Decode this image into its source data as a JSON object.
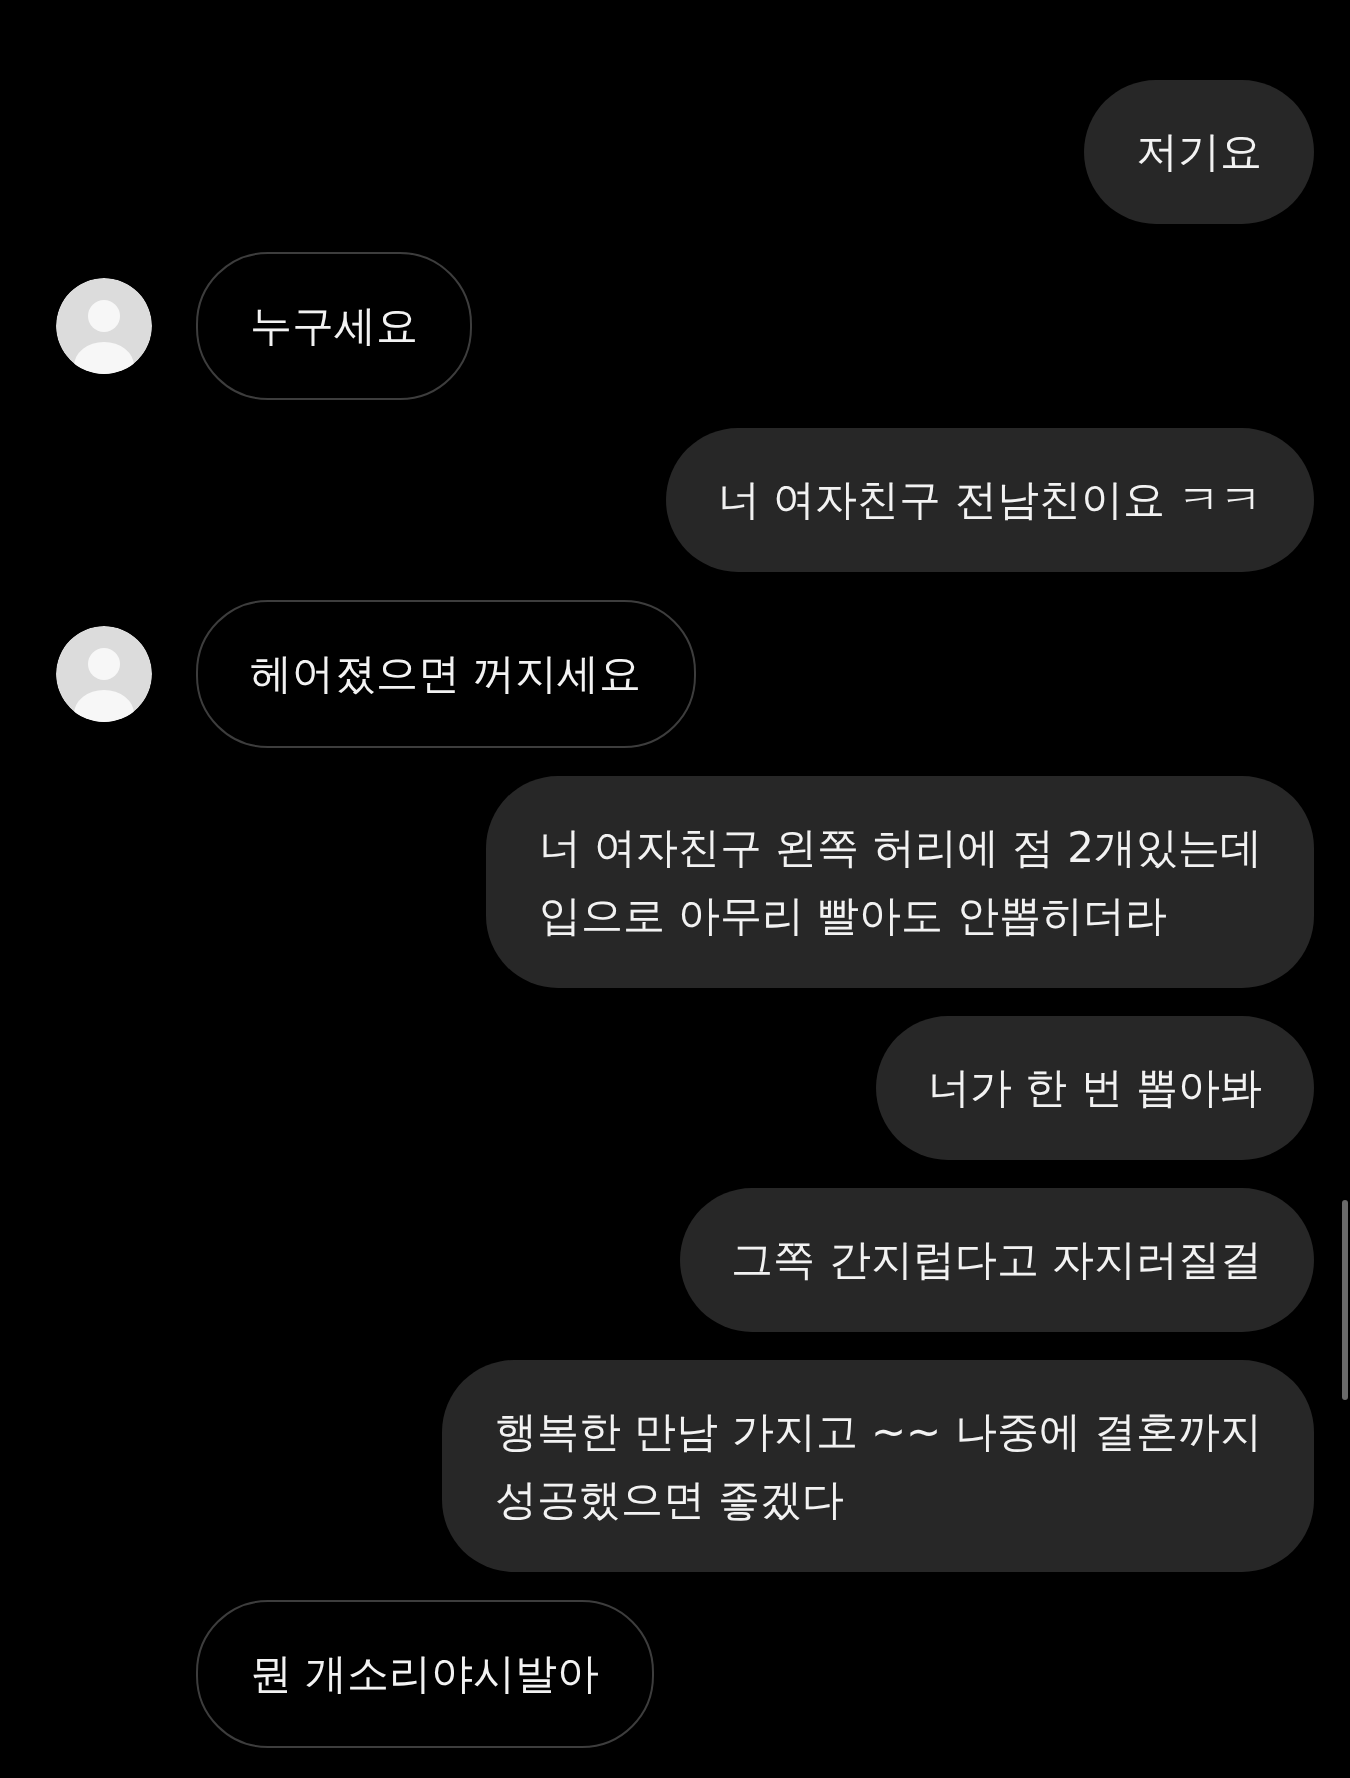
{
  "messages": [
    {
      "kind": "sent",
      "text": "저기요"
    },
    {
      "kind": "received",
      "text": "누구세요",
      "avatar": true
    },
    {
      "kind": "sent",
      "text": "너 여자친구 전남친이요 ㅋㅋ"
    },
    {
      "kind": "received",
      "text": "헤어졌으면 꺼지세요",
      "avatar": true
    },
    {
      "kind": "sent",
      "text": "너 여자친구 왼쪽 허리에 점 2개있는데\n입으로 아무리 빨아도 안뽑히더라"
    },
    {
      "kind": "sent",
      "text": "너가 한 번 뽑아봐"
    },
    {
      "kind": "sent",
      "text": "그쪽 간지럽다고 자지러질걸"
    },
    {
      "kind": "sent",
      "text": "행복한 만남 가지고 ~~ 나중에 결혼까지\n성공했으면 좋겠다"
    },
    {
      "kind": "received",
      "text": "뭔 개소리야시발아",
      "avatar": false
    }
  ]
}
